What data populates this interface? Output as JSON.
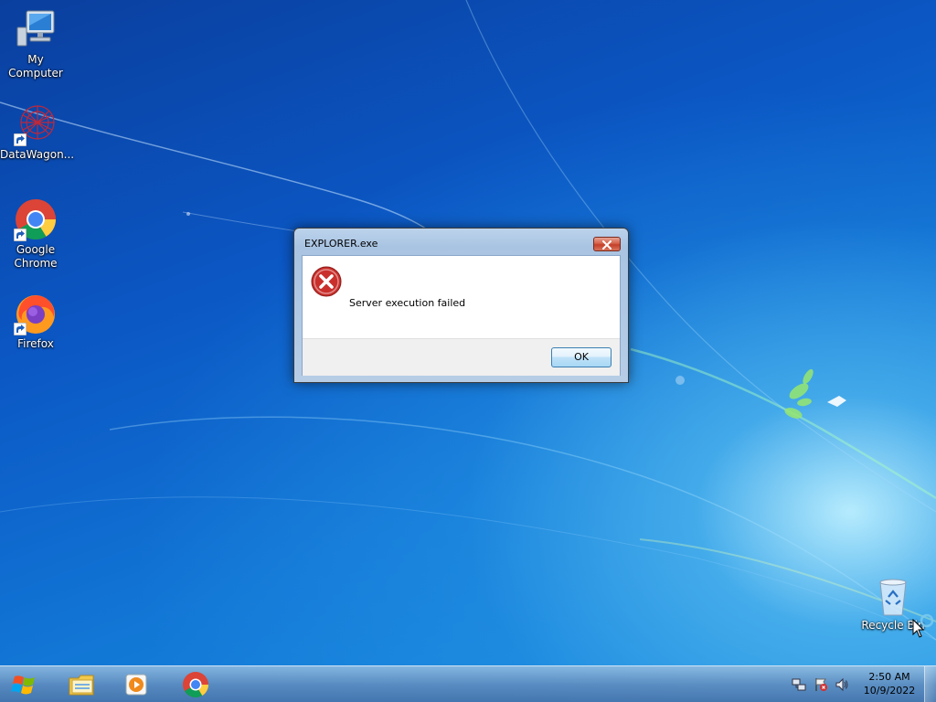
{
  "desktop": {
    "icons": [
      {
        "label": "My Computer",
        "icon": "computer-icon"
      },
      {
        "label": "DataWagon...",
        "icon": "datawagon-icon"
      },
      {
        "label": "Google Chrome",
        "icon": "chrome-icon"
      },
      {
        "label": "Firefox",
        "icon": "firefox-icon"
      },
      {
        "label": "Recycle Bin",
        "icon": "recycle-bin-icon"
      }
    ]
  },
  "dialog": {
    "title": "EXPLORER.exe",
    "message": "Server execution failed",
    "ok_label": "OK",
    "icon": "error-icon"
  },
  "taskbar": {
    "start_icon": "windows-logo-icon",
    "pinned": [
      {
        "icon": "file-explorer-icon"
      },
      {
        "icon": "media-player-icon"
      },
      {
        "icon": "chrome-icon"
      }
    ],
    "tray": [
      {
        "icon": "network-icon"
      },
      {
        "icon": "action-center-flag-icon"
      },
      {
        "icon": "speaker-icon"
      }
    ],
    "clock": {
      "time": "2:50 AM",
      "date": "10/9/2022"
    }
  },
  "colors": {
    "dialog_ok_border": "#3c7fb1",
    "close_button": "#c4402a",
    "error_red": "#c9302c"
  }
}
